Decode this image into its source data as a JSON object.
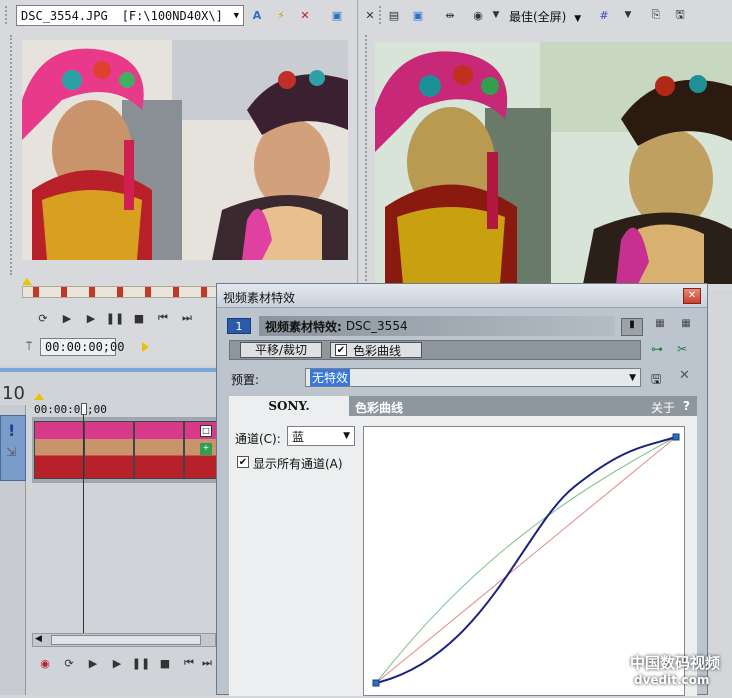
{
  "left_preview": {
    "file_name": "DSC_3554.JPG",
    "file_path": "[F:\\100ND40X\\]",
    "timecode": "00:00:00;00"
  },
  "right_preview": {
    "quality": "最佳(全屏)"
  },
  "timeline": {
    "track_number": "10",
    "timecode": "00:00:00;00"
  },
  "dialog": {
    "title": "视频素材特效",
    "badge": "1",
    "header_label": "视频素材特效:",
    "header_clip": "DSC_3554",
    "chain": [
      "平移/裁切",
      "色彩曲线"
    ],
    "preset_label": "预置:",
    "preset_value": "无特效",
    "brand": "SONY.",
    "plugin_name": "色彩曲线",
    "about": "关于",
    "help": "?",
    "channel_label": "通道(C):",
    "channel_value": "蓝",
    "show_all_label": "显示所有通道(A)"
  },
  "watermark": {
    "line1": "中国数码视频",
    "line2": "dvedit.com"
  },
  "colors": {
    "accent": "#2b6fc8",
    "curve_blue": "#1a237e",
    "curve_green": "#7fc08a",
    "curve_red": "#e08a8a"
  }
}
